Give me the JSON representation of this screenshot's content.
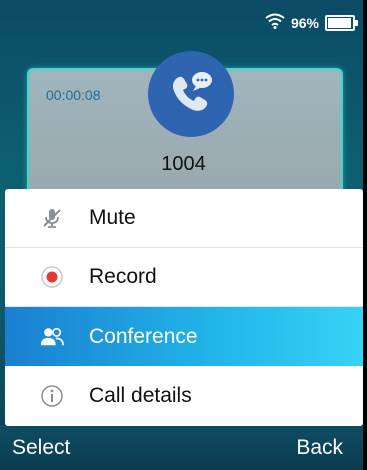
{
  "status_bar": {
    "wifi_icon": "wifi-icon",
    "battery_percent": "96%",
    "battery_icon": "battery-icon"
  },
  "call": {
    "duration": "00:00:08",
    "avatar_icon": "phone-chat-icon",
    "number": "1004"
  },
  "menu": {
    "items": [
      {
        "label": "Mute",
        "icon": "microphone-muted-icon",
        "selected": false
      },
      {
        "label": "Record",
        "icon": "record-icon",
        "selected": false
      },
      {
        "label": "Conference",
        "icon": "conference-icon",
        "selected": true
      },
      {
        "label": "Call details",
        "icon": "info-icon",
        "selected": false
      }
    ]
  },
  "softkeys": {
    "left": "Select",
    "right": "Back"
  },
  "colors": {
    "accent_selected": "#22b6ea",
    "record_red": "#e53935",
    "card_border": "#3fd8d0"
  }
}
